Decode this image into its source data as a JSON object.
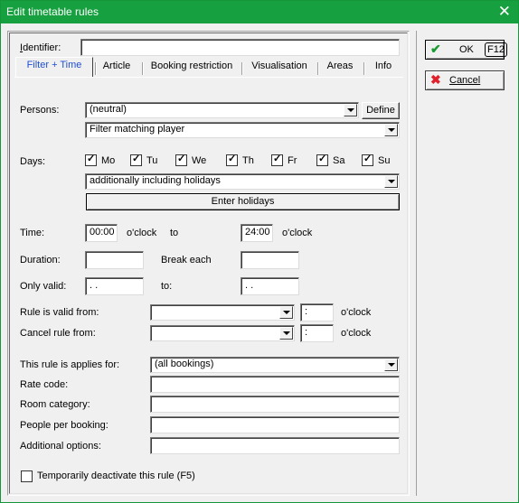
{
  "window": {
    "title": "Edit timetable rules",
    "close_icon": "close-icon"
  },
  "identifier": {
    "label": "Identifier:",
    "value": ""
  },
  "tabs": [
    {
      "label": "Filter + Time",
      "active": true
    },
    {
      "label": "Article"
    },
    {
      "label": "Booking restriction"
    },
    {
      "label": "Visualisation"
    },
    {
      "label": "Areas"
    },
    {
      "label": "Info"
    }
  ],
  "persons": {
    "label": "Persons:",
    "value": "(neutral)",
    "define_label": "Define",
    "filter_value": "Filter matching player"
  },
  "days": {
    "label": "Days:",
    "items": [
      {
        "label": "Mo",
        "checked": true
      },
      {
        "label": "Tu",
        "checked": true
      },
      {
        "label": "We",
        "checked": true
      },
      {
        "label": "Th",
        "checked": true
      },
      {
        "label": "Fr",
        "checked": true
      },
      {
        "label": "Sa",
        "checked": true
      },
      {
        "label": "Su",
        "checked": true
      }
    ],
    "holiday_mode": "additionally including holidays",
    "enter_holidays_label": "Enter holidays"
  },
  "time": {
    "label": "Time:",
    "from": "00:00",
    "from_unit": "o'clock",
    "to_label": "to",
    "to": "24:00",
    "to_unit": "o'clock"
  },
  "duration": {
    "label": "Duration:",
    "value": "",
    "break_label": "Break each",
    "break_value": ""
  },
  "only_valid": {
    "label": "Only valid:",
    "from": " .  .",
    "to_label": "to:",
    "to": " .  ."
  },
  "rule_valid_from": {
    "label": "Rule is valid from:",
    "date": "",
    "time": ":",
    "unit": "o'clock"
  },
  "cancel_rule_from": {
    "label": "Cancel rule from:",
    "date": "",
    "time": ":",
    "unit": "o'clock"
  },
  "applies_for": {
    "label": "This rule is applies for:",
    "value": "(all bookings)"
  },
  "rate_code": {
    "label": "Rate code:",
    "value": ""
  },
  "room_category": {
    "label": "Room category:",
    "value": ""
  },
  "people_per_booking": {
    "label": "People per booking:",
    "value": ""
  },
  "additional_options": {
    "label": "Additional options:",
    "value": ""
  },
  "deactivate": {
    "label": "Temporarily deactivate this rule (F5)",
    "checked": false
  },
  "actions": {
    "ok_label": "OK",
    "ok_shortcut": "F12",
    "cancel_label": "Cancel"
  },
  "colors": {
    "titlebar": "#16a03f",
    "active_tab": "#1f4fd1",
    "ok_check": "#1a9a30",
    "cancel_x": "#e0202a"
  }
}
